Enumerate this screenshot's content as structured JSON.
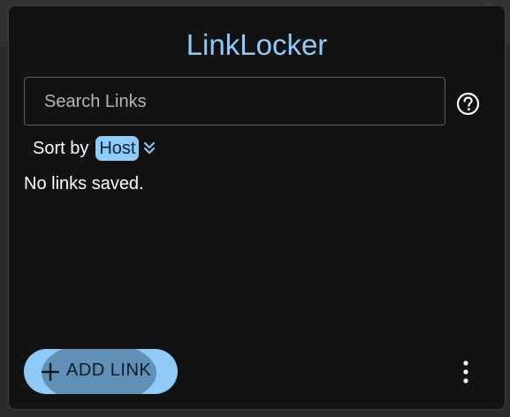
{
  "app": {
    "title": "LinkLocker"
  },
  "search": {
    "placeholder": "Search Links",
    "value": ""
  },
  "sort": {
    "label": "Sort by",
    "selected": "Host"
  },
  "links": {
    "empty_message": "No links saved.",
    "items": []
  },
  "actions": {
    "add_label": "ADD LINK"
  },
  "icons": {
    "help": "help-circle-icon",
    "chevron": "double-chevron-down-icon",
    "plus": "plus-icon",
    "more": "more-vertical-icon"
  },
  "colors": {
    "accent": "#90caf9",
    "background": "#121212",
    "text": "#ffffff"
  }
}
